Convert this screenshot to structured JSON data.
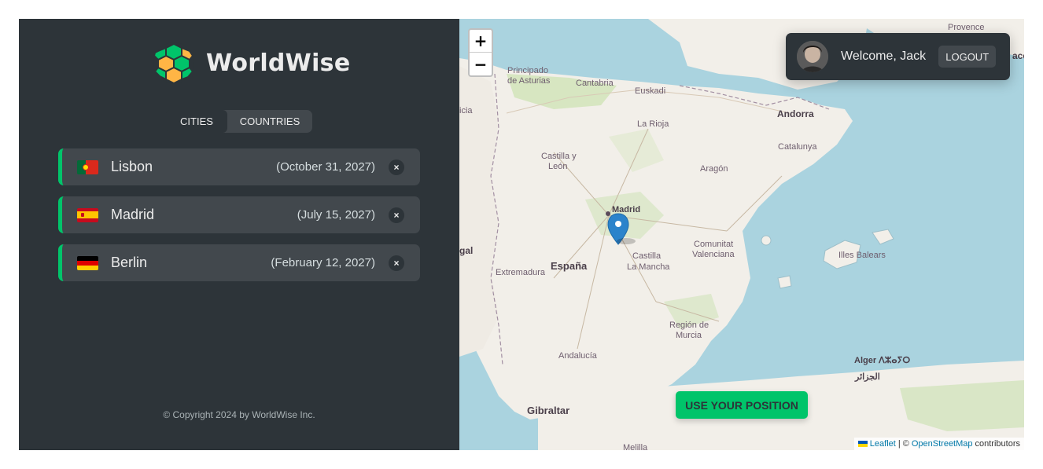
{
  "brand": {
    "name": "WorldWise",
    "logo_icon": "globe-hex-icon"
  },
  "tabs": [
    {
      "label": "Cities",
      "active": true
    },
    {
      "label": "Countries",
      "active": false
    }
  ],
  "cities": [
    {
      "name": "Lisbon",
      "date": "(October 31, 2027)",
      "flag": "portugal-flag-icon",
      "delete": "×"
    },
    {
      "name": "Madrid",
      "date": "(July 15, 2027)",
      "flag": "spain-flag-icon",
      "delete": "×"
    },
    {
      "name": "Berlin",
      "date": "(February 12, 2027)",
      "flag": "germany-flag-icon",
      "delete": "×"
    }
  ],
  "footer": {
    "copyright": "© Copyright 2024 by WorldWise Inc."
  },
  "map": {
    "zoom_in": "+",
    "zoom_out": "−",
    "user": {
      "welcome": "Welcome, Jack",
      "logout": "Logout"
    },
    "use_position": "Use your position",
    "attribution": {
      "leaflet": "Leaflet",
      "separator": "| ©",
      "osm": "OpenStreetMap",
      "suffix": "contributors"
    },
    "labels": {
      "provence": "Provence",
      "principado": "Principado",
      "asturias": "de Asturias",
      "cantabria": "Cantabria",
      "euskadi": "Euskadi",
      "larioja": "La Rioja",
      "andorra": "Andorra",
      "catalunya": "Catalunya",
      "castilla": "Castilla y",
      "leon": "León",
      "aragon": "Aragón",
      "madrid": "Madrid",
      "espana": "España",
      "gal": "gal",
      "extremadura": "Extremadura",
      "clm1": "Castilla",
      "clm2": "La Mancha",
      "cv1": "Comunitat",
      "cv2": "Valenciana",
      "baleares": "Illes Balears",
      "murcia1": "Región de",
      "murcia2": "Murcia",
      "andalucia": "Andalucía",
      "alger": "Alger ⴷⵣⴰⵢⵔ",
      "aljazair": "الجزائر",
      "gibraltar": "Gibraltar",
      "melilla": "Melilla",
      "acc": "acc",
      "cia": "icia"
    }
  },
  "colors": {
    "accent": "#00c46a",
    "sidebar": "#2d3439",
    "card": "#42484d",
    "sea": "#aad3df",
    "land": "#f2efe9"
  }
}
